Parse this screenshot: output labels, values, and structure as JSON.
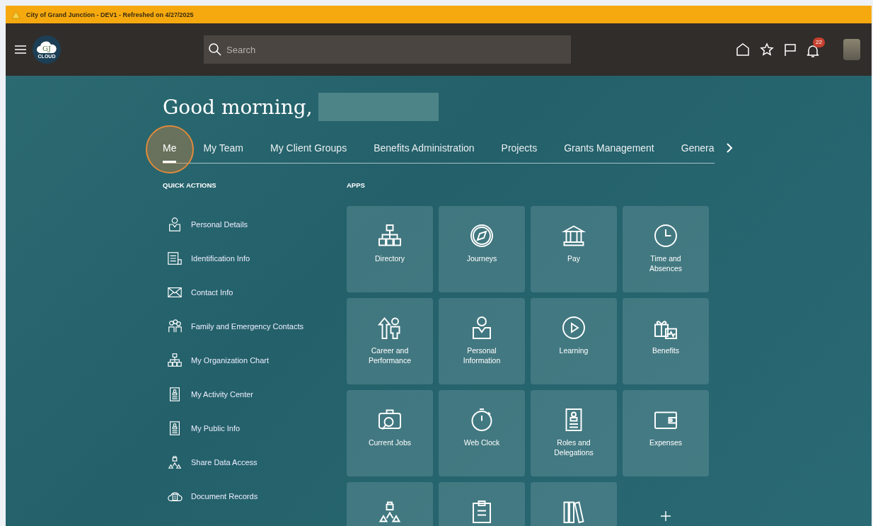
{
  "banner": {
    "text": "City of Grand Junction - DEV1 - Refreshed on 4/27/2025"
  },
  "header": {
    "logo_mark": "GJ",
    "logo_text": "CLOUD",
    "search": {
      "placeholder": "Search"
    },
    "notifications": {
      "count": "22"
    }
  },
  "greeting": {
    "text": "Good morning,",
    "name_redacted": true
  },
  "tabs": [
    {
      "label": "Me",
      "selected": true,
      "highlighted": true
    },
    {
      "label": "My Team",
      "selected": false,
      "highlighted": false
    },
    {
      "label": "My Client Groups",
      "selected": false,
      "highlighted": false
    },
    {
      "label": "Benefits Administration",
      "selected": false,
      "highlighted": false
    },
    {
      "label": "Projects",
      "selected": false,
      "highlighted": false
    },
    {
      "label": "Grants Management",
      "selected": false,
      "highlighted": false
    },
    {
      "label": "Genera",
      "selected": false,
      "highlighted": false
    }
  ],
  "quick_actions": {
    "title": "QUICK ACTIONS",
    "items": [
      "Personal Details",
      "Identification Info",
      "Contact Info",
      "Family and Emergency Contacts",
      "My Organization Chart",
      "My Activity Center",
      "My Public Info",
      "Share Data Access",
      "Document Records"
    ]
  },
  "apps": {
    "title": "APPS",
    "tiles": [
      {
        "kind": "full",
        "label": "Directory"
      },
      {
        "kind": "full",
        "label": "Journeys"
      },
      {
        "kind": "full",
        "label": "Pay"
      },
      {
        "kind": "full",
        "label": "Time and Absences"
      },
      {
        "kind": "full",
        "label": "Career and Performance"
      },
      {
        "kind": "full",
        "label": "Personal Information"
      },
      {
        "kind": "full",
        "label": "Learning"
      },
      {
        "kind": "full",
        "label": "Benefits"
      },
      {
        "kind": "full",
        "label": "Current Jobs"
      },
      {
        "kind": "full",
        "label": "Web Clock"
      },
      {
        "kind": "full",
        "label": "Roles and Delegations"
      },
      {
        "kind": "full",
        "label": "Expenses"
      },
      {
        "kind": "partial"
      },
      {
        "kind": "partial"
      },
      {
        "kind": "partial"
      },
      {
        "kind": "add"
      }
    ]
  }
}
